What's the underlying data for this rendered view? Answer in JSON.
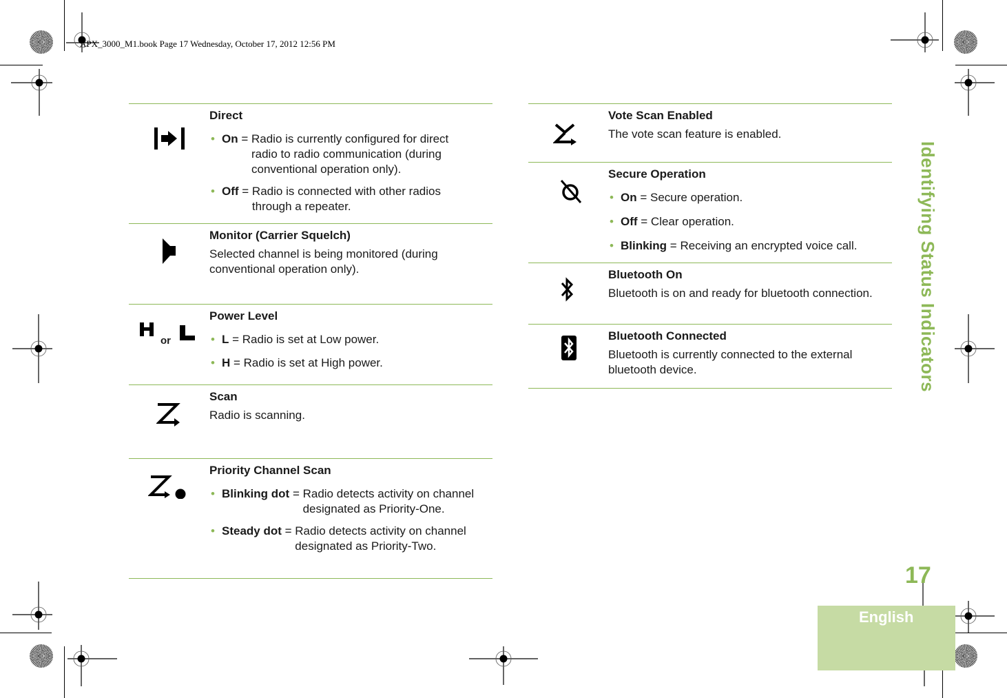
{
  "header": {
    "book_info": "APX_3000_M1.book  Page 17  Wednesday, October 17, 2012  12:56 PM"
  },
  "section_title": "Identifying Status Indicators",
  "page_number": "17",
  "language_tab": "English",
  "colors": {
    "accent_green": "#8db857",
    "tab_green": "#c6dba4"
  },
  "left_table": [
    {
      "icon": "direct-icon",
      "title": "Direct",
      "bullets": [
        {
          "term": "On",
          "sep": " = ",
          "text": "Radio is currently configured for direct radio to radio communication (during conventional operation only)."
        },
        {
          "term": "Off",
          "sep": " = ",
          "text": "Radio is connected with other radios through a repeater."
        }
      ]
    },
    {
      "icon": "monitor-speaker-icon",
      "title": "Monitor (Carrier Squelch)",
      "description": "Selected channel is being monitored (during conventional operation only)."
    },
    {
      "icon": "power-level-icon",
      "icon_or_label": "or",
      "title": "Power Level",
      "bullets": [
        {
          "term": "L",
          "sep": " = ",
          "text": "Radio is set at Low power."
        },
        {
          "term": "H",
          "sep": " = ",
          "text": "Radio is set at High power."
        }
      ]
    },
    {
      "icon": "scan-icon",
      "title": "Scan",
      "description": "Radio is scanning."
    },
    {
      "icon": "priority-scan-icon",
      "title": "Priority Channel Scan",
      "bullets": [
        {
          "term": "Blinking dot",
          "sep": " = ",
          "text": "Radio detects activity on channel designated as Priority-One."
        },
        {
          "term": "Steady dot",
          "sep": " = ",
          "text": "Radio detects activity on channel designated as Priority-Two."
        }
      ]
    }
  ],
  "right_table": [
    {
      "icon": "vote-scan-icon",
      "title": "Vote Scan Enabled",
      "description": "The vote scan feature is enabled."
    },
    {
      "icon": "secure-operation-icon",
      "title": "Secure Operation",
      "bullets": [
        {
          "term": "On",
          "sep": " = ",
          "text": "Secure operation."
        },
        {
          "term": "Off",
          "sep": " = ",
          "text": "Clear operation."
        },
        {
          "term": "Blinking",
          "sep": " = ",
          "text": "Receiving an encrypted voice call."
        }
      ]
    },
    {
      "icon": "bluetooth-on-icon",
      "title": "Bluetooth On",
      "description": "Bluetooth is on and ready for bluetooth connection."
    },
    {
      "icon": "bluetooth-connected-icon",
      "title": "Bluetooth Connected",
      "description": "Bluetooth is currently connected to the external bluetooth device."
    }
  ]
}
